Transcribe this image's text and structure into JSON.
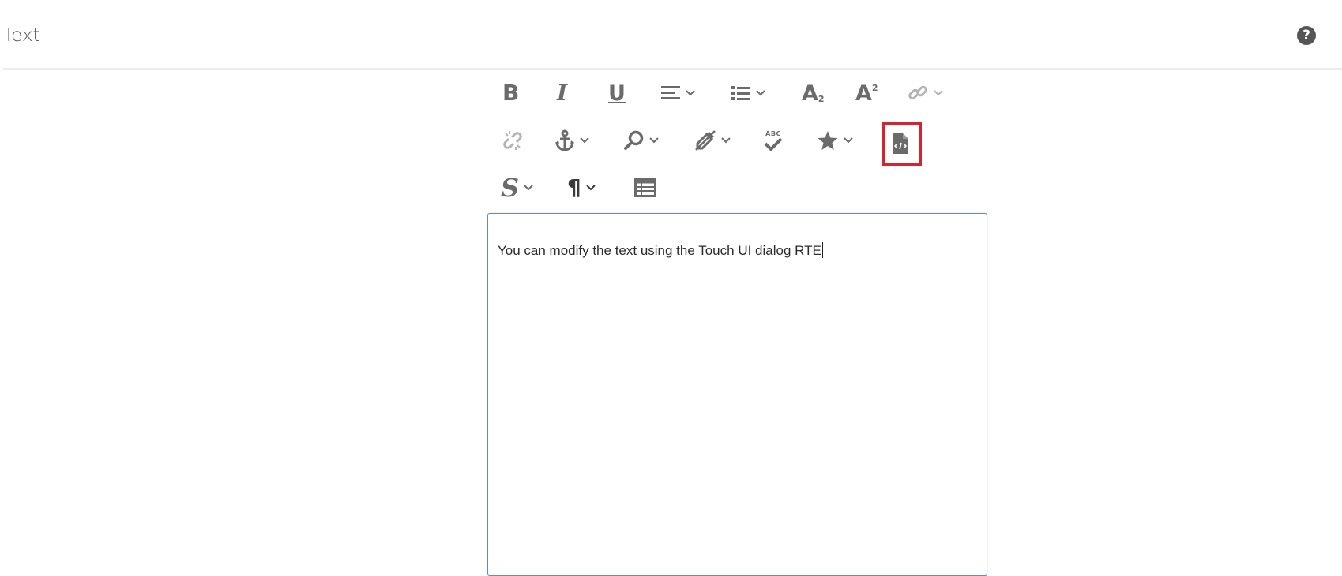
{
  "dialog": {
    "title": "Text",
    "help_label": "?"
  },
  "toolbar": {
    "row1": [
      {
        "name": "bold-button",
        "glyph": "B",
        "icon": "bold-icon"
      },
      {
        "name": "italic-button",
        "glyph": "I",
        "icon": "italic-icon"
      },
      {
        "name": "underline-button",
        "glyph": "U",
        "icon": "underline-icon"
      },
      {
        "name": "justify-dropdown",
        "icon": "align-left-icon"
      },
      {
        "name": "list-dropdown",
        "icon": "bulleted-list-icon"
      },
      {
        "name": "subscript-button",
        "glyph": "A",
        "icon": "subscript-icon",
        "index": "2"
      },
      {
        "name": "superscript-button",
        "glyph": "A",
        "icon": "superscript-icon",
        "index": "2"
      },
      {
        "name": "link-dropdown",
        "icon": "link-icon",
        "disabled": true
      }
    ],
    "row2": [
      {
        "name": "unlink-button",
        "icon": "unlink-icon",
        "disabled": true
      },
      {
        "name": "anchor-dropdown",
        "icon": "anchor-icon"
      },
      {
        "name": "find-replace-dropdown",
        "icon": "search-icon"
      },
      {
        "name": "remove-format-dropdown",
        "icon": "clear-format-icon"
      },
      {
        "name": "spellcheck-button",
        "icon": "spellcheck-icon",
        "glyph": "ABC"
      },
      {
        "name": "special-chars-dropdown",
        "icon": "star-icon"
      },
      {
        "name": "source-edit-button",
        "icon": "code-file-icon",
        "highlighted": true
      }
    ],
    "row3": [
      {
        "name": "styles-dropdown",
        "glyph": "S",
        "icon": "styles-icon"
      },
      {
        "name": "paragraph-format-dropdown",
        "glyph": "¶",
        "icon": "pilcrow-icon"
      },
      {
        "name": "table-button",
        "icon": "table-icon"
      }
    ]
  },
  "editor": {
    "content": "You can modify the text using the Touch UI dialog RTE"
  },
  "colors": {
    "icon": "#6b6b6b",
    "icon_disabled": "#b4b4b4",
    "highlight": "#d7232f",
    "editor_border": "#6e8aa8"
  }
}
